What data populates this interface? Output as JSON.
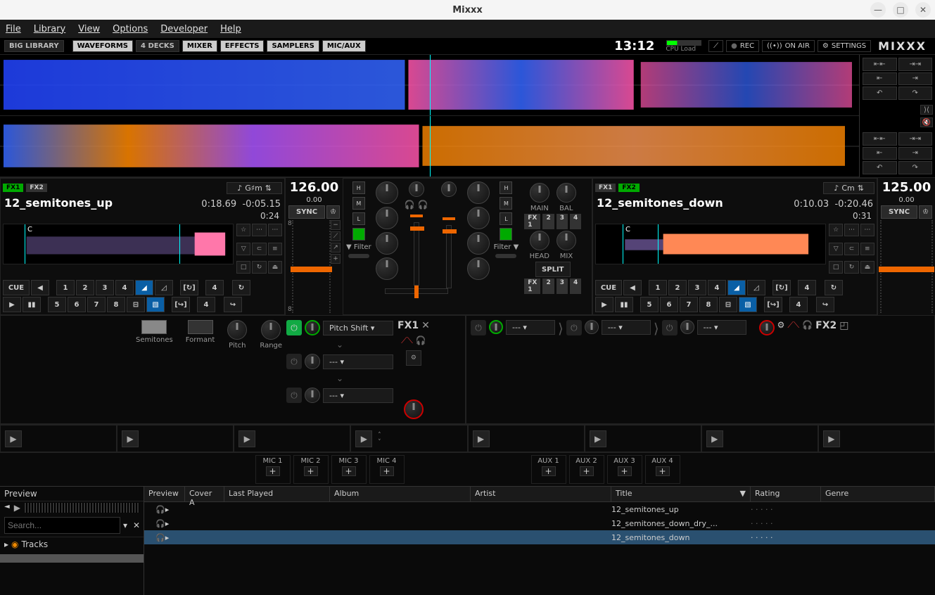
{
  "window": {
    "title": "Mixxx"
  },
  "menubar": [
    "File",
    "Library",
    "View",
    "Options",
    "Developer",
    "Help"
  ],
  "toolbar": {
    "big_library": "BIG LIBRARY",
    "waveforms": "WAVEFORMS",
    "four_decks": "4 DECKS",
    "mixer": "MIXER",
    "effects": "EFFECTS",
    "samplers": "SAMPLERS",
    "micaux": "MIC/AUX",
    "clock": "13:12",
    "cpu": "CPU Load",
    "rec": "REC",
    "onair": "ON AIR",
    "settings": "SETTINGS",
    "logo": "MIXXX"
  },
  "deck1": {
    "fx1": "FX1",
    "fx2": "FX2",
    "key": "G♯m",
    "title": "12_semitones_up",
    "elapsed": "0:18.69",
    "remaining": "-0:05.15",
    "duration": "0:24",
    "bpm": "126.00",
    "rate": "0.00",
    "sync": "SYNC",
    "cue": "CUE",
    "hotcues": [
      "1",
      "2",
      "3",
      "4",
      "5",
      "6",
      "7",
      "8"
    ],
    "cue_marker": "C",
    "mini_rate": "8"
  },
  "deck2": {
    "fx1": "FX1",
    "fx2": "FX2",
    "key": "Cm",
    "title": "12_semitones_down",
    "elapsed": "0:10.03",
    "remaining": "-0:20.46",
    "duration": "0:31",
    "bpm": "125.00",
    "rate": "0.00",
    "sync": "SYNC",
    "cue": "CUE",
    "hotcues": [
      "1",
      "2",
      "3",
      "4",
      "5",
      "6",
      "7",
      "8"
    ],
    "cue_marker": "C"
  },
  "mixer": {
    "h": "H",
    "m": "M",
    "l": "L",
    "filter": "Filter",
    "main": "MAIN",
    "bal": "BAL",
    "head": "HEAD",
    "mix": "MIX",
    "split": "SPLIT",
    "fx_assign": [
      "FX 1",
      "2",
      "3",
      "4"
    ]
  },
  "fx": {
    "semitones": "Semitones",
    "formant": "Formant",
    "pitch": "Pitch",
    "range": "Range",
    "pitch_shift": "Pitch Shift",
    "none": "---",
    "fx1": "FX1",
    "fx2": "FX2"
  },
  "micaux": {
    "mics": [
      "MIC 1",
      "MIC 2",
      "MIC 3",
      "MIC 4"
    ],
    "auxs": [
      "AUX 1",
      "AUX 2",
      "AUX 3",
      "AUX 4"
    ]
  },
  "library": {
    "preview": "Preview",
    "search_placeholder": "Search...",
    "tracks": "Tracks",
    "columns": {
      "preview": "Preview",
      "cover": "Cover A",
      "last": "Last Played",
      "album": "Album",
      "artist": "Artist",
      "title": "Title",
      "rating": "Rating",
      "genre": "Genre"
    },
    "rows": [
      {
        "title": "12_semitones_up"
      },
      {
        "title": "12_semitones_down_dry_..."
      },
      {
        "title": "12_semitones_down"
      }
    ]
  }
}
